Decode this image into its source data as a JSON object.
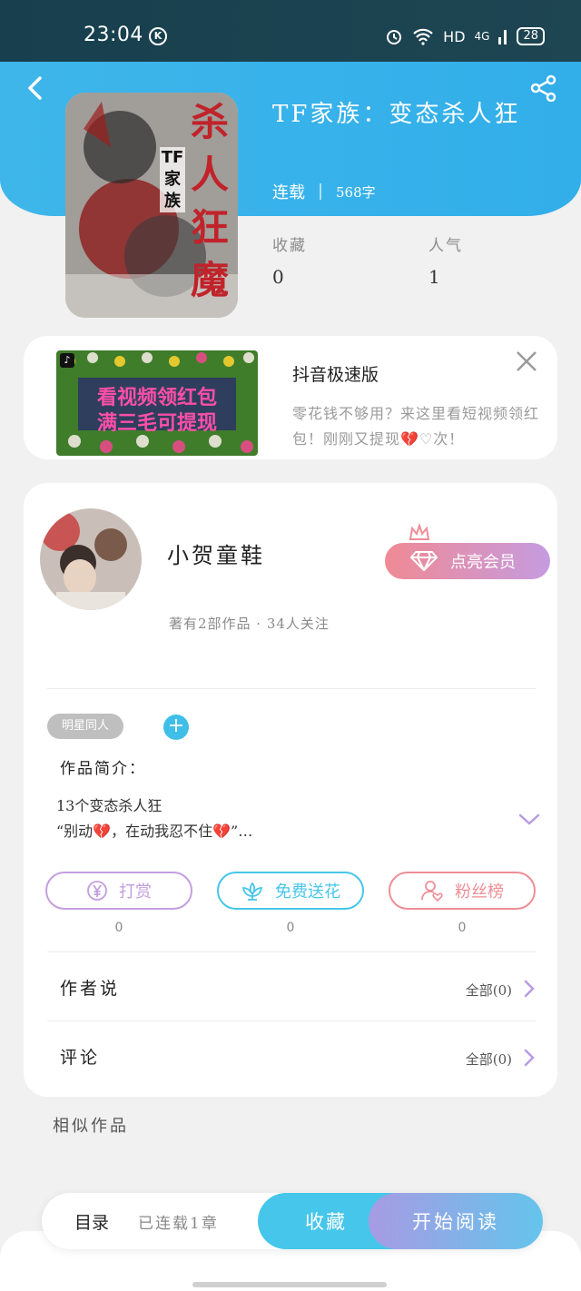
{
  "status_bar": {
    "time": "23:04",
    "k_icon": "K",
    "network": "HD",
    "signal_type": "4G",
    "battery": "28"
  },
  "book": {
    "title": "TF家族：变态杀人狂",
    "status": "连载",
    "word_count": "568字",
    "cover_text": {
      "main": "杀人狂魔",
      "badge": "TF家族"
    },
    "favorites_label": "收藏",
    "favorites_value": "0",
    "popularity_label": "人气",
    "popularity_value": "1"
  },
  "ad": {
    "thumb_line1": "看视频领红包",
    "thumb_line2": "满三毛可提现",
    "title": "抖音极速版",
    "description": "零花钱不够用？来这里看短视频领红包！刚刚又提现💔♡次！"
  },
  "author": {
    "name": "小贺童鞋",
    "meta": "著有2部作品 · 34人关注",
    "vip_button": "点亮会员"
  },
  "tags": [
    "明星同人"
  ],
  "intro": {
    "heading": "作品简介：",
    "line1": "13个变态杀人狂",
    "line2": "“别动💔，在动我忍不住💔”…"
  },
  "actions": [
    {
      "label": "打赏",
      "count": "0",
      "color": "#c49ee0"
    },
    {
      "label": "免费送花",
      "count": "0",
      "color": "#46c6ea"
    },
    {
      "label": "粉丝榜",
      "count": "0",
      "color": "#ee8e96"
    }
  ],
  "rows": {
    "author_says": {
      "label": "作者说",
      "value": "全部(0)"
    },
    "comments": {
      "label": "评论",
      "value": "全部(0)"
    }
  },
  "similar_heading": "相似作品",
  "bottom": {
    "toc_label": "目录",
    "chapter_status": "已连载1章",
    "favorite_button": "收藏",
    "read_button": "开始阅读"
  },
  "colors": {
    "header": "#3eb6ea",
    "accent_purple": "#c49ee0",
    "accent_pink": "#ee8e96"
  }
}
